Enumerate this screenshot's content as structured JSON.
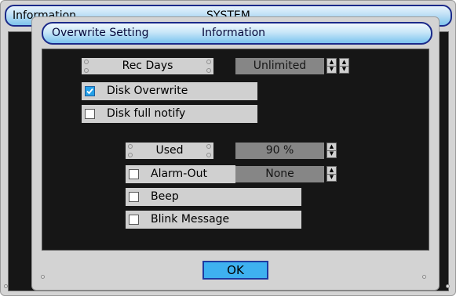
{
  "background_window": {
    "title_left": "Information",
    "title_center": "SYSTEM"
  },
  "dialog": {
    "tab_active": "Overwrite Setting",
    "tab_other": "Information",
    "rec_days": {
      "label": "Rec Days",
      "value": "Unlimited"
    },
    "disk_overwrite": {
      "label": "Disk Overwrite",
      "checked": true
    },
    "disk_full_notify": {
      "label": "Disk full notify",
      "checked": false
    },
    "used": {
      "label": "Used",
      "value": "90 %"
    },
    "alarm_out": {
      "label": "Alarm-Out",
      "value": "None",
      "checked": false
    },
    "beep": {
      "label": "Beep",
      "checked": false
    },
    "blink_message": {
      "label": "Blink Message",
      "checked": false
    },
    "ok_label": "OK"
  },
  "icons": {
    "spin_up": "up-arrow-icon",
    "spin_down": "down-arrow-icon",
    "check": "checkmark-icon"
  },
  "colors": {
    "title_gradient_top": "#e8f3fc",
    "title_gradient_bottom": "#7fc4ec",
    "title_border": "#1b2a8a",
    "panel_black": "#161616",
    "control_gray": "#d0d0d0",
    "value_gray": "#868686",
    "ok_button": "#3eb1f0",
    "checkbox_on": "#23a0e8"
  }
}
